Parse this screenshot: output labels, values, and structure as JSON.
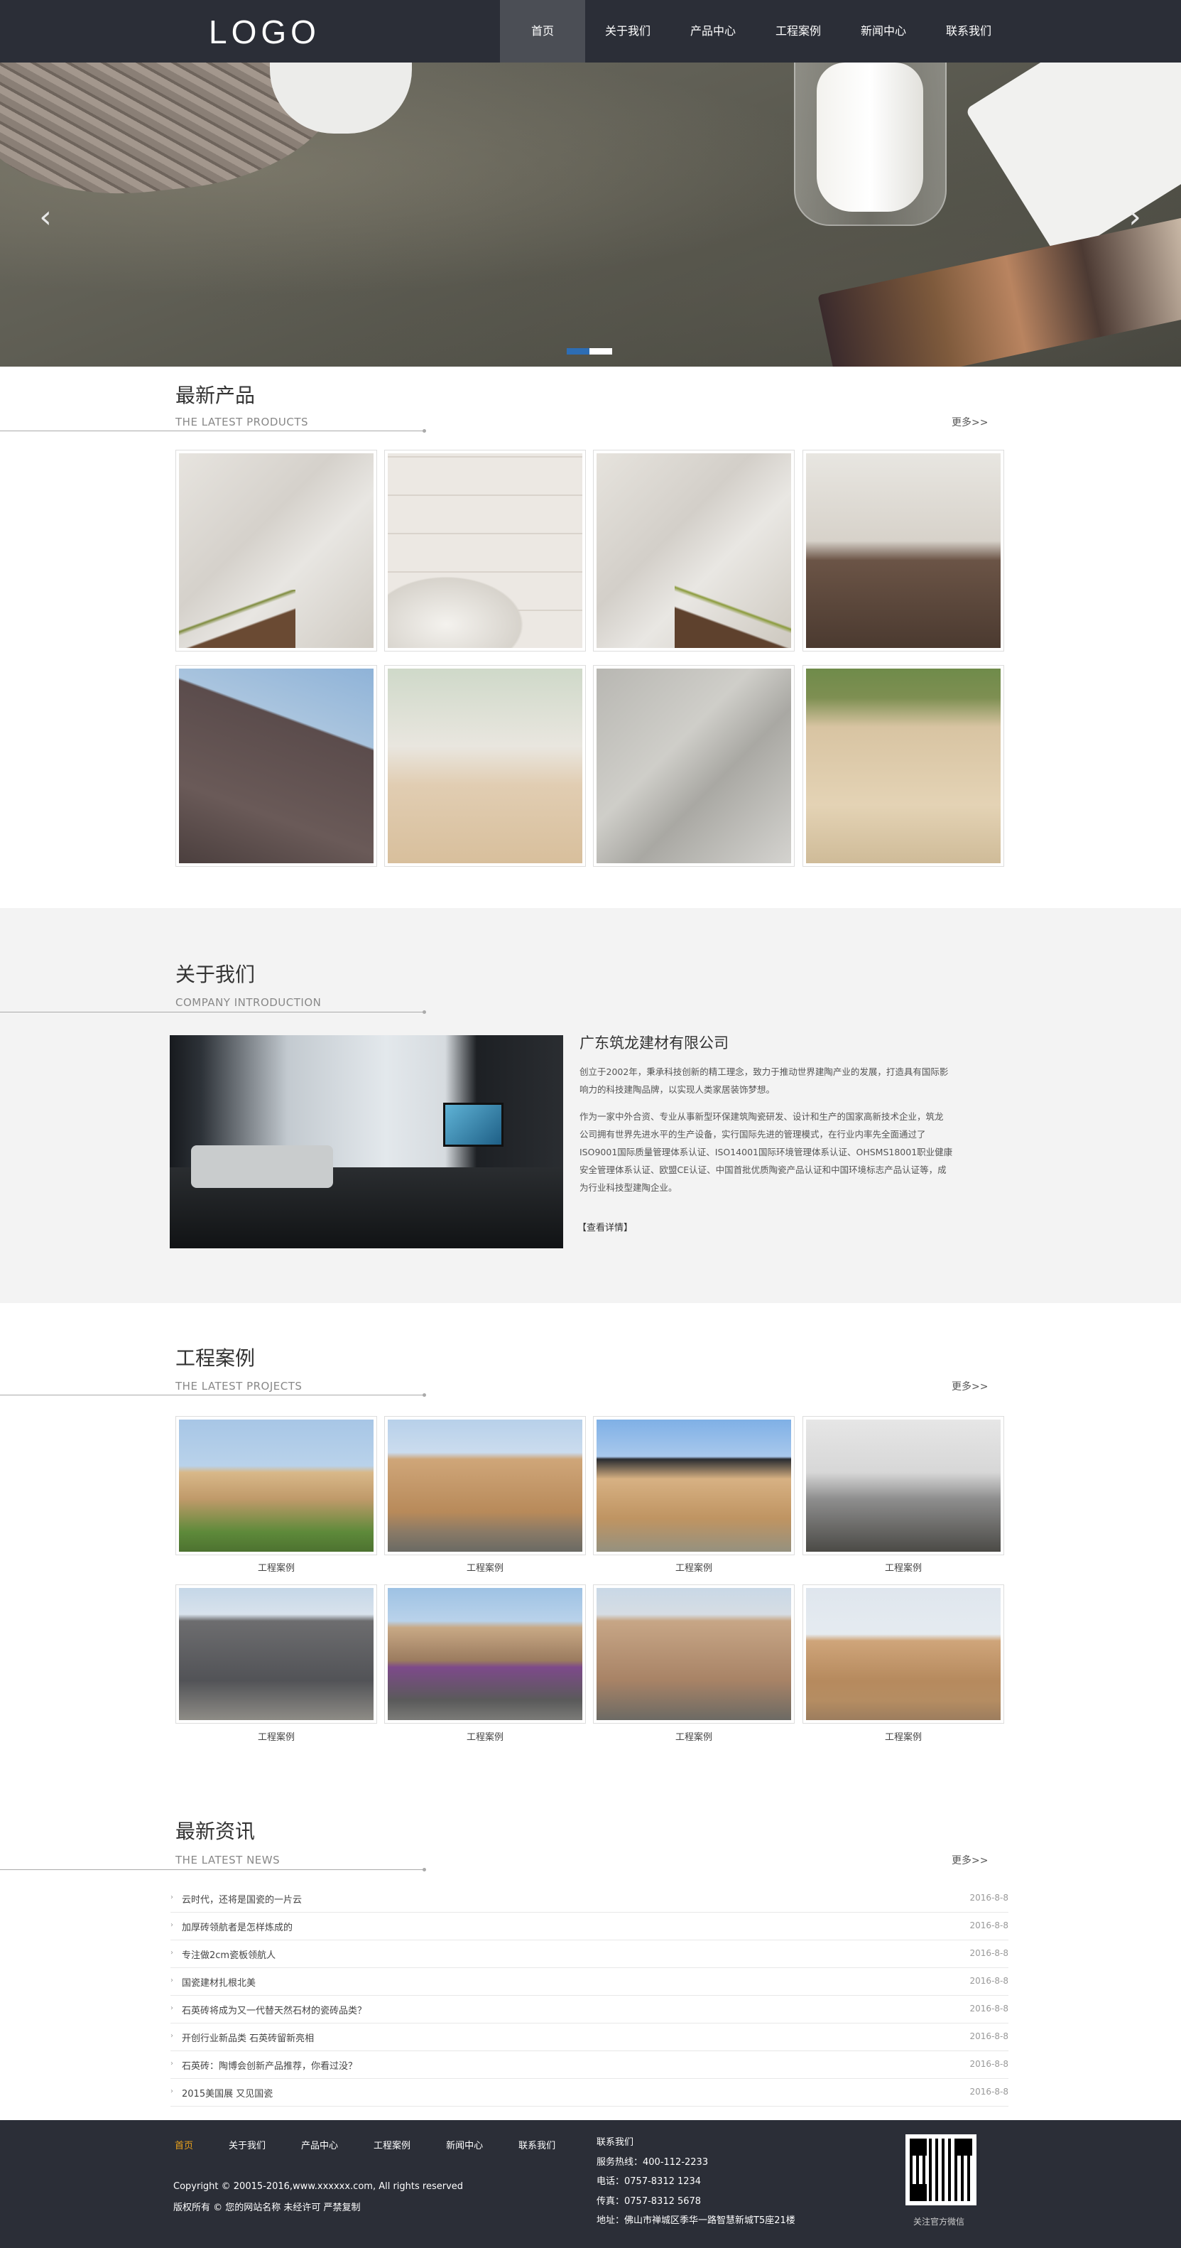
{
  "header": {
    "logo": "LOGO",
    "nav": [
      "首页",
      "关于我们",
      "产品中心",
      "工程案例",
      "新闻中心",
      "联系我们"
    ]
  },
  "banner": {
    "prev_icon": "chevron-left-icon",
    "next_icon": "chevron-right-icon",
    "prev_glyph": "‹",
    "next_glyph": "›",
    "slides": 2,
    "active_slide": 1,
    "accent": "#2d6db4"
  },
  "products": {
    "title": "最新产品",
    "subtitle": "THE LATEST PRODUCTS",
    "more": "更多>>"
  },
  "about": {
    "title": "关于我们",
    "subtitle": "COMPANY INTRODUCTION",
    "company": "广东筑龙建材有限公司",
    "p1_l1": "创立于2002年，秉承科技创新的精工理念，致力于推动世界建陶产业的发展，打造具有国际影",
    "p1_l2": "响力的科技建陶品牌，以实现人类家居装饰梦想。",
    "p2_l1": "作为一家中外合资、专业从事新型环保建筑陶瓷研发、设计和生产的国家高新技术企业，筑龙",
    "p2_l2": "公司拥有世界先进水平的生产设备，实行国际先进的管理模式，在行业内率先全面通过了",
    "p2_l3": "ISO9001国际质量管理体系认证、ISO14001国际环境管理体系认证、OHSMS18001职业健康",
    "p2_l4": "安全管理体系认证、欧盟CE认证、中国首批优质陶瓷产品认证和中国环境标志产品认证等，成",
    "p2_l5": "为行业科技型建陶企业。",
    "more": "【查看详情】"
  },
  "cases": {
    "title": "工程案例",
    "subtitle": "THE LATEST PROJECTS",
    "more": "更多>>",
    "captions": [
      "工程案例",
      "工程案例",
      "工程案例",
      "工程案例",
      "工程案例",
      "工程案例",
      "工程案例",
      "工程案例"
    ]
  },
  "news": {
    "title": "最新资讯",
    "subtitle": "THE LATEST NEWS",
    "more": "更多>>",
    "bullet": "›",
    "items": [
      {
        "title": "云时代，还将是国瓷的一片云",
        "date": "2016-8-8"
      },
      {
        "title": "加厚砖领航者是怎样炼成的",
        "date": "2016-8-8"
      },
      {
        "title": "专注做2cm瓷板领航人",
        "date": "2016-8-8"
      },
      {
        "title": "国瓷建材扎根北美",
        "date": "2016-8-8"
      },
      {
        "title": "石英砖将成为又一代替天然石材的瓷砖品类？",
        "date": "2016-8-8"
      },
      {
        "title": "开创行业新品类 石英砖留新亮相",
        "date": "2016-8-8"
      },
      {
        "title": "石英砖：陶博会创新产品推荐，你看过没？",
        "date": "2016-8-8"
      },
      {
        "title": "2015美国展 又见国瓷",
        "date": "2016-8-8"
      }
    ]
  },
  "footer": {
    "nav": [
      "首页",
      "关于我们",
      "产品中心",
      "工程案例",
      "新闻中心",
      "联系我们"
    ],
    "copyright": "Copyright © 20015-2016,www.xxxxxx.com, All rights reserved",
    "rights": "版权所有 © 您的网站名称 未经许可 严禁复制",
    "contact_title": "联系我们",
    "hotline": "服务热线：400-112-2233",
    "phone": "电话：0757-8312 1234",
    "fax": "传真：0757-8312 5678",
    "address": "地址：佛山市禅城区季华一路智慧新城T5座21楼",
    "qr_caption": "关注官方微信",
    "highlight": "#e9a11b"
  }
}
